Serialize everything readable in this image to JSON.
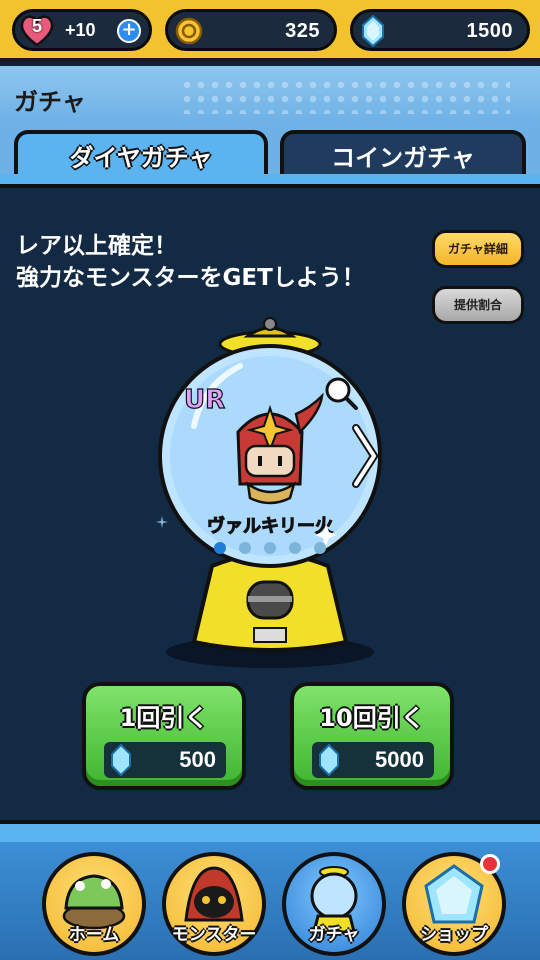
{
  "status": {
    "hearts": "5",
    "heart_bonus": "+10",
    "add_symbol": "+",
    "coins": "325",
    "gems": "1500"
  },
  "header": {
    "title": "ガチャ"
  },
  "tabs": [
    {
      "label": "ダイヤガチャ",
      "active": true
    },
    {
      "label": "コインガチャ",
      "active": false
    }
  ],
  "main": {
    "headline_line1": "レア以上確定！",
    "headline_line2": "強力なモンスターをGETしよう！",
    "detail_button": "ガチャ詳細",
    "rate_button": "提供割合",
    "featured": {
      "rarity": "UR",
      "monster_name": "ヴァルキリー火",
      "carousel_total": 5,
      "carousel_active": 1
    },
    "pulls": [
      {
        "label": "1回引く",
        "cost": "500"
      },
      {
        "label": "10回引く",
        "cost": "5000"
      }
    ]
  },
  "nav": [
    {
      "label": "ホーム",
      "active": false
    },
    {
      "label": "モンスター",
      "active": false
    },
    {
      "label": "ガチャ",
      "active": true
    },
    {
      "label": "ショップ",
      "active": false,
      "notification": true
    }
  ],
  "colors": {
    "gold": "#f3c22f",
    "sky": "#5bb3ef",
    "navy": "#132a44",
    "green": "#3fb52f",
    "rarity_ur": "#e0a0ff"
  }
}
